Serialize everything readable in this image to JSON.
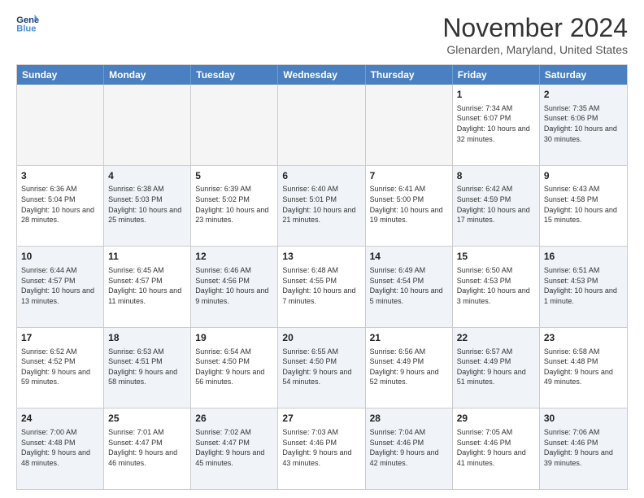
{
  "header": {
    "logo_line1": "General",
    "logo_line2": "Blue",
    "title": "November 2024",
    "location": "Glenarden, Maryland, United States"
  },
  "calendar": {
    "days_of_week": [
      "Sunday",
      "Monday",
      "Tuesday",
      "Wednesday",
      "Thursday",
      "Friday",
      "Saturday"
    ],
    "weeks": [
      [
        {
          "day": "",
          "info": "",
          "shaded": true
        },
        {
          "day": "",
          "info": "",
          "shaded": true
        },
        {
          "day": "",
          "info": "",
          "shaded": true
        },
        {
          "day": "",
          "info": "",
          "shaded": true
        },
        {
          "day": "",
          "info": "",
          "shaded": true
        },
        {
          "day": "1",
          "info": "Sunrise: 7:34 AM\nSunset: 6:07 PM\nDaylight: 10 hours and 32 minutes.",
          "shaded": false
        },
        {
          "day": "2",
          "info": "Sunrise: 7:35 AM\nSunset: 6:06 PM\nDaylight: 10 hours and 30 minutes.",
          "shaded": true
        }
      ],
      [
        {
          "day": "3",
          "info": "Sunrise: 6:36 AM\nSunset: 5:04 PM\nDaylight: 10 hours and 28 minutes.",
          "shaded": false
        },
        {
          "day": "4",
          "info": "Sunrise: 6:38 AM\nSunset: 5:03 PM\nDaylight: 10 hours and 25 minutes.",
          "shaded": true
        },
        {
          "day": "5",
          "info": "Sunrise: 6:39 AM\nSunset: 5:02 PM\nDaylight: 10 hours and 23 minutes.",
          "shaded": false
        },
        {
          "day": "6",
          "info": "Sunrise: 6:40 AM\nSunset: 5:01 PM\nDaylight: 10 hours and 21 minutes.",
          "shaded": true
        },
        {
          "day": "7",
          "info": "Sunrise: 6:41 AM\nSunset: 5:00 PM\nDaylight: 10 hours and 19 minutes.",
          "shaded": false
        },
        {
          "day": "8",
          "info": "Sunrise: 6:42 AM\nSunset: 4:59 PM\nDaylight: 10 hours and 17 minutes.",
          "shaded": true
        },
        {
          "day": "9",
          "info": "Sunrise: 6:43 AM\nSunset: 4:58 PM\nDaylight: 10 hours and 15 minutes.",
          "shaded": false
        }
      ],
      [
        {
          "day": "10",
          "info": "Sunrise: 6:44 AM\nSunset: 4:57 PM\nDaylight: 10 hours and 13 minutes.",
          "shaded": true
        },
        {
          "day": "11",
          "info": "Sunrise: 6:45 AM\nSunset: 4:57 PM\nDaylight: 10 hours and 11 minutes.",
          "shaded": false
        },
        {
          "day": "12",
          "info": "Sunrise: 6:46 AM\nSunset: 4:56 PM\nDaylight: 10 hours and 9 minutes.",
          "shaded": true
        },
        {
          "day": "13",
          "info": "Sunrise: 6:48 AM\nSunset: 4:55 PM\nDaylight: 10 hours and 7 minutes.",
          "shaded": false
        },
        {
          "day": "14",
          "info": "Sunrise: 6:49 AM\nSunset: 4:54 PM\nDaylight: 10 hours and 5 minutes.",
          "shaded": true
        },
        {
          "day": "15",
          "info": "Sunrise: 6:50 AM\nSunset: 4:53 PM\nDaylight: 10 hours and 3 minutes.",
          "shaded": false
        },
        {
          "day": "16",
          "info": "Sunrise: 6:51 AM\nSunset: 4:53 PM\nDaylight: 10 hours and 1 minute.",
          "shaded": true
        }
      ],
      [
        {
          "day": "17",
          "info": "Sunrise: 6:52 AM\nSunset: 4:52 PM\nDaylight: 9 hours and 59 minutes.",
          "shaded": false
        },
        {
          "day": "18",
          "info": "Sunrise: 6:53 AM\nSunset: 4:51 PM\nDaylight: 9 hours and 58 minutes.",
          "shaded": true
        },
        {
          "day": "19",
          "info": "Sunrise: 6:54 AM\nSunset: 4:50 PM\nDaylight: 9 hours and 56 minutes.",
          "shaded": false
        },
        {
          "day": "20",
          "info": "Sunrise: 6:55 AM\nSunset: 4:50 PM\nDaylight: 9 hours and 54 minutes.",
          "shaded": true
        },
        {
          "day": "21",
          "info": "Sunrise: 6:56 AM\nSunset: 4:49 PM\nDaylight: 9 hours and 52 minutes.",
          "shaded": false
        },
        {
          "day": "22",
          "info": "Sunrise: 6:57 AM\nSunset: 4:49 PM\nDaylight: 9 hours and 51 minutes.",
          "shaded": true
        },
        {
          "day": "23",
          "info": "Sunrise: 6:58 AM\nSunset: 4:48 PM\nDaylight: 9 hours and 49 minutes.",
          "shaded": false
        }
      ],
      [
        {
          "day": "24",
          "info": "Sunrise: 7:00 AM\nSunset: 4:48 PM\nDaylight: 9 hours and 48 minutes.",
          "shaded": true
        },
        {
          "day": "25",
          "info": "Sunrise: 7:01 AM\nSunset: 4:47 PM\nDaylight: 9 hours and 46 minutes.",
          "shaded": false
        },
        {
          "day": "26",
          "info": "Sunrise: 7:02 AM\nSunset: 4:47 PM\nDaylight: 9 hours and 45 minutes.",
          "shaded": true
        },
        {
          "day": "27",
          "info": "Sunrise: 7:03 AM\nSunset: 4:46 PM\nDaylight: 9 hours and 43 minutes.",
          "shaded": false
        },
        {
          "day": "28",
          "info": "Sunrise: 7:04 AM\nSunset: 4:46 PM\nDaylight: 9 hours and 42 minutes.",
          "shaded": true
        },
        {
          "day": "29",
          "info": "Sunrise: 7:05 AM\nSunset: 4:46 PM\nDaylight: 9 hours and 41 minutes.",
          "shaded": false
        },
        {
          "day": "30",
          "info": "Sunrise: 7:06 AM\nSunset: 4:46 PM\nDaylight: 9 hours and 39 minutes.",
          "shaded": true
        }
      ]
    ]
  }
}
